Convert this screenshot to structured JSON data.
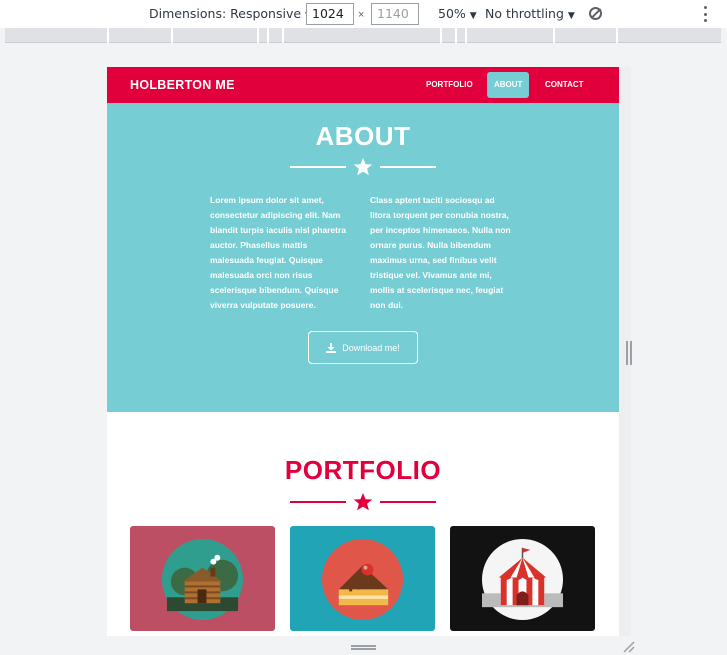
{
  "devtools": {
    "dimensions_label": "Dimensions: Responsive",
    "width_value": "1024",
    "height_placeholder": "1140",
    "times": "×",
    "zoom": "50%",
    "throttle": "No throttling",
    "caret": "▼"
  },
  "site": {
    "brand": "HOLBERTON ME",
    "nav": [
      {
        "label": "PORTFOLIO",
        "active": false
      },
      {
        "label": "ABOUT",
        "active": true
      },
      {
        "label": "CONTACT",
        "active": false
      }
    ],
    "about": {
      "title": "ABOUT",
      "col1": "Lorem ipsum dolor sit amet, consectetur adipiscing elit. Nam blandit turpis iaculis nisl pharetra auctor. Phasellus mattis malesuada feugiat. Quisque malesuada orci non risus scelerisque bibendum. Quisque viverra vulputate posuere.",
      "col2": "Class aptent taciti sociosqu ad litora torquent per conubia nostra, per inceptos himenaeos. Nulla non ornare purus. Nulla bibendum maximus urna, sed finibus velit tristique vel. Vivamus ante mi, mollis at scelerisque nec, feugiat non dui.",
      "button": "Download me!"
    },
    "portfolio": {
      "title": "PORTFOLIO",
      "cards": [
        {
          "name": "cabin-image",
          "bg": "#bc4f63"
        },
        {
          "name": "cake-image",
          "bg": "#21a4b6"
        },
        {
          "name": "circus-tent-image",
          "bg": "#121212"
        }
      ]
    }
  },
  "colors": {
    "primary": "#e1003c",
    "teal": "#76cdd3"
  }
}
